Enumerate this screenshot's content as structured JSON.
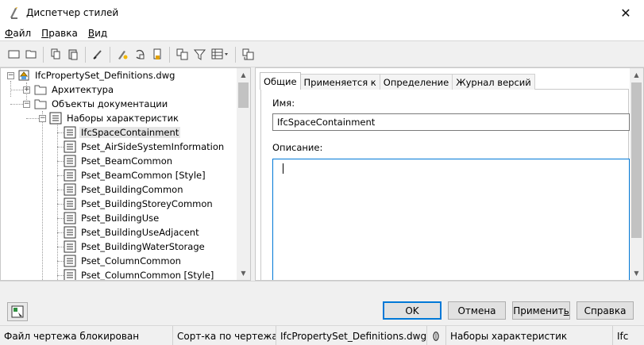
{
  "window": {
    "title": "Диспетчер стилей",
    "close_glyph": "✕"
  },
  "menu": [
    {
      "underlined": "Ф",
      "rest": "айл"
    },
    {
      "underlined": "П",
      "rest": "равка"
    },
    {
      "underlined": "В",
      "rest": "ид"
    }
  ],
  "toolbar_icons": [
    "new-drawing-icon",
    "open-drawing-icon",
    "copy-icon",
    "paste-icon",
    "purge-icon",
    "edit-style-icon",
    "set-from-icon",
    "lock-icon",
    "toggle-view-icon",
    "filter-icon",
    "view-options-icon",
    "sort-icon"
  ],
  "tree": {
    "root": "IfcPropertySet_Definitions.dwg",
    "folders": [
      "Архитектура",
      "Объекты документации"
    ],
    "category": "Наборы характеристик",
    "items": [
      "IfcSpaceContainment",
      "Pset_AirSideSystemInformation",
      "Pset_BeamCommon",
      "Pset_BeamCommon [Style]",
      "Pset_BuildingCommon",
      "Pset_BuildingStoreyCommon",
      "Pset_BuildingUse",
      "Pset_BuildingUseAdjacent",
      "Pset_BuildingWaterStorage",
      "Pset_ColumnCommon",
      "Pset_ColumnCommon [Style]"
    ],
    "selected_index": 0
  },
  "tabs": [
    "Общие",
    "Применяется к",
    "Определение",
    "Журнал версий"
  ],
  "general": {
    "name_label": "Имя:",
    "name_value": "IfcSpaceContainment",
    "description_label": "Описание:",
    "description_value": ""
  },
  "buttons": {
    "ok": "OK",
    "cancel": "Отмена",
    "apply_underlined": "ь",
    "apply_before": "Применит",
    "help": "Справка"
  },
  "status": {
    "lock_state": "Файл чертежа блокирован",
    "sort": "Сорт-ка по чертежам",
    "drawing": "IfcPropertySet_Definitions.dwg",
    "category": "Наборы характеристик",
    "tail": "Ifc"
  },
  "colors": {
    "accent": "#0078d7",
    "selection": "#e5e5e5"
  }
}
